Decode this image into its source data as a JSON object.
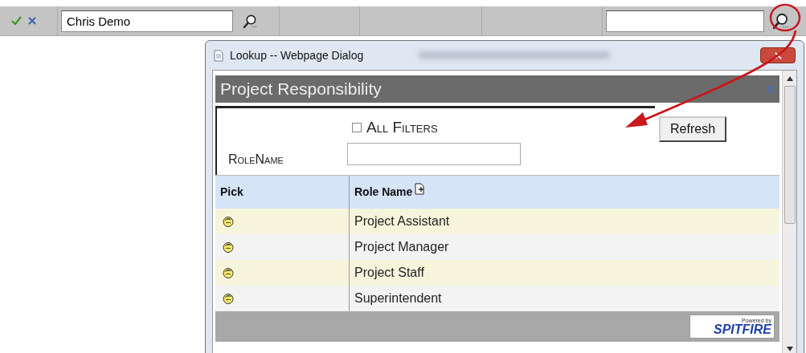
{
  "toolbar": {
    "name_field": {
      "value": "Chris Demo"
    }
  },
  "dialog": {
    "title": "Lookup -- Webpage Dialog",
    "panel_title": "Project Responsibility",
    "filters": {
      "all_filters": {
        "label": "All Filters",
        "checked": false
      },
      "role_name": {
        "label": "RoleName"
      },
      "refresh": "Refresh"
    },
    "table": {
      "columns": [
        "Pick",
        "Role Name"
      ],
      "rows": [
        {
          "role": "Project Assistant"
        },
        {
          "role": "Project Manager"
        },
        {
          "role": "Project Staff"
        },
        {
          "role": "Superintendent"
        }
      ]
    },
    "footer": {
      "logo_caption": "Powered by",
      "logo_text": "SPITFIRE"
    }
  }
}
